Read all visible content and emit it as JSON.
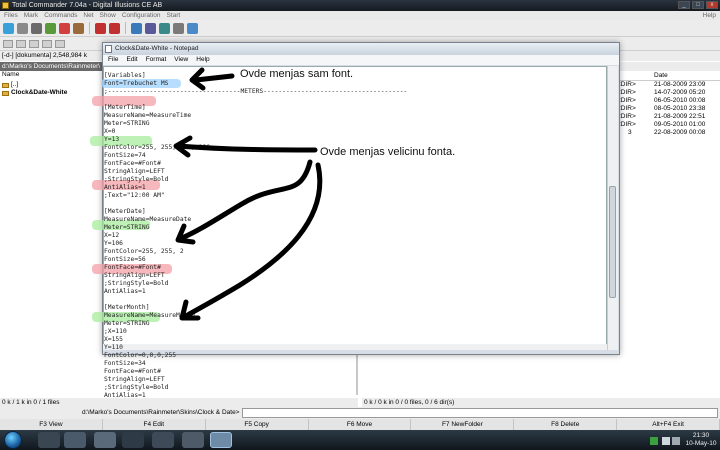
{
  "tc": {
    "title": "Total Commander 7.04a - Digital Illusions CE AB",
    "menu": [
      "Files",
      "Mark",
      "Commands",
      "Net",
      "Show",
      "Configuration",
      "Start"
    ],
    "menu_help": "Help",
    "left": {
      "drive": "[-d-]",
      "drive_label": "[dokumenta]",
      "free_space": "2,548,984 k",
      "path": "d:\\Marko's Documents\\Rainmeter\\",
      "header_name": "Name",
      "items": [
        "[..]",
        "Clock&Date-White"
      ]
    },
    "right": {
      "header_date": "Date",
      "rows": [
        {
          "label": "<DIR>",
          "date": "21-08-2009 23:09"
        },
        {
          "label": "<DIR>",
          "date": "14-07-2009 05:20"
        },
        {
          "label": "<DIR>",
          "date": "06-05-2010 00:08"
        },
        {
          "label": "<DIR>",
          "date": "08-05-2010 23:38"
        },
        {
          "label": "<DIR>",
          "date": "21-08-2009 22:51"
        },
        {
          "label": "<DIR>",
          "date": "09-05-2010 01:00"
        },
        {
          "label": "3",
          "date": "22-08-2009 00:08"
        }
      ]
    },
    "status_left": "0 k / 1 k in 0 / 1 files",
    "status_right": "0 k / 0 k in 0 / 0 files, 0 / 6 dir(s)",
    "cmd_path": "d:\\Marko's Documents\\Rainmeter\\Skins\\Clock & Date>",
    "fkeys": [
      "F3 View",
      "F4 Edit",
      "F5 Copy",
      "F6 Move",
      "F7 NewFolder",
      "F8 Delete",
      "Alt+F4 Exit"
    ]
  },
  "notepad": {
    "title": "Clock&Date-White - Notepad",
    "menu": [
      "File",
      "Edit",
      "Format",
      "View",
      "Help"
    ],
    "lines": [
      "[Variables]",
      "Font=Trebuchet MS",
      ";-----------------------------------METERS--------------------------------------",
      "",
      "[MeterTime]",
      "MeasureName=MeasureTime",
      "Meter=STRING",
      "X=0",
      "Y=13",
      "FontColor=255, 255, 255, 220",
      "FontSize=74",
      "FontFace=#Font#",
      "StringAlign=LEFT",
      ";StringStyle=Bold",
      "AntiAlias=1",
      ";Text=\"12:00 AM\"",
      "",
      "[MeterDate]",
      "MeasureName=MeasureDate",
      "Meter=STRING",
      "X=12",
      "Y=106",
      "FontColor=255, 255, 2",
      "FontSize=56",
      "FontFace=#Font#",
      "StringAlign=LEFT",
      ";StringStyle=Bold",
      "AntiAlias=1",
      "",
      "[MeterMonth]",
      "MeasureName=MeasureMonth",
      "Meter=STRING",
      ";X=110",
      "X=155",
      "Y=110",
      "FontColor=0,0,0,255",
      "FontSize=34",
      "FontFace=#Font#",
      "StringAlign=LEFT",
      ";StringStyle=Bold",
      "AntiAlias=1"
    ]
  },
  "annotations": {
    "font": "Ovde menjas sam font.",
    "size": "Ovde menjas velicinu fonta."
  },
  "tray": {
    "time": "21:30",
    "date": "10-May-10"
  },
  "colors": {
    "highlight_red": "#f3a0a6",
    "highlight_green": "#a8ec9c",
    "highlight_blue": "#9fd3ff"
  }
}
